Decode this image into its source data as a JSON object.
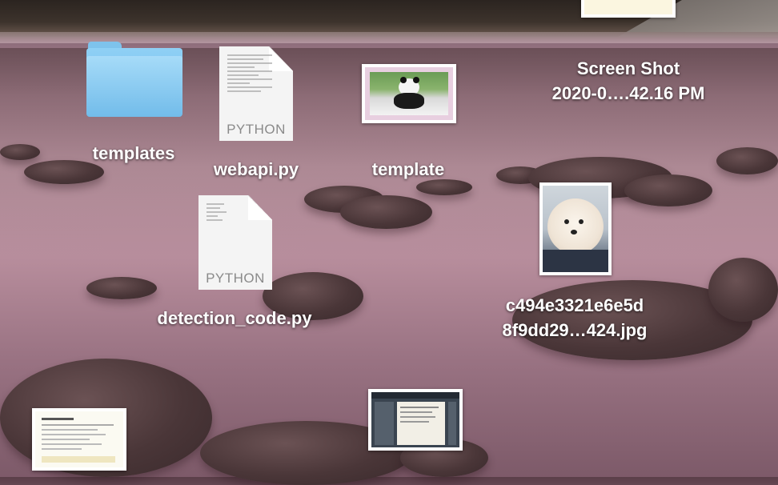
{
  "desktop": {
    "items": [
      {
        "name": "templates",
        "kind": "folder"
      },
      {
        "name": "webapi.py",
        "kind": "python",
        "type_label": "PYTHON"
      },
      {
        "name": "template",
        "kind": "image"
      },
      {
        "name": "Screen Shot\n2020-0….42.16 PM",
        "line1": "Screen Shot",
        "line2": "2020-0….42.16 PM",
        "kind": "screenshot"
      },
      {
        "name": "detection_code.py",
        "kind": "python",
        "type_label": "PYTHON"
      },
      {
        "line1": "c494e3321e6e5d",
        "line2": "8f9dd29…424.jpg",
        "kind": "image"
      }
    ]
  },
  "colors": {
    "folder": "#72bcea",
    "label_text": "#ffffff"
  }
}
